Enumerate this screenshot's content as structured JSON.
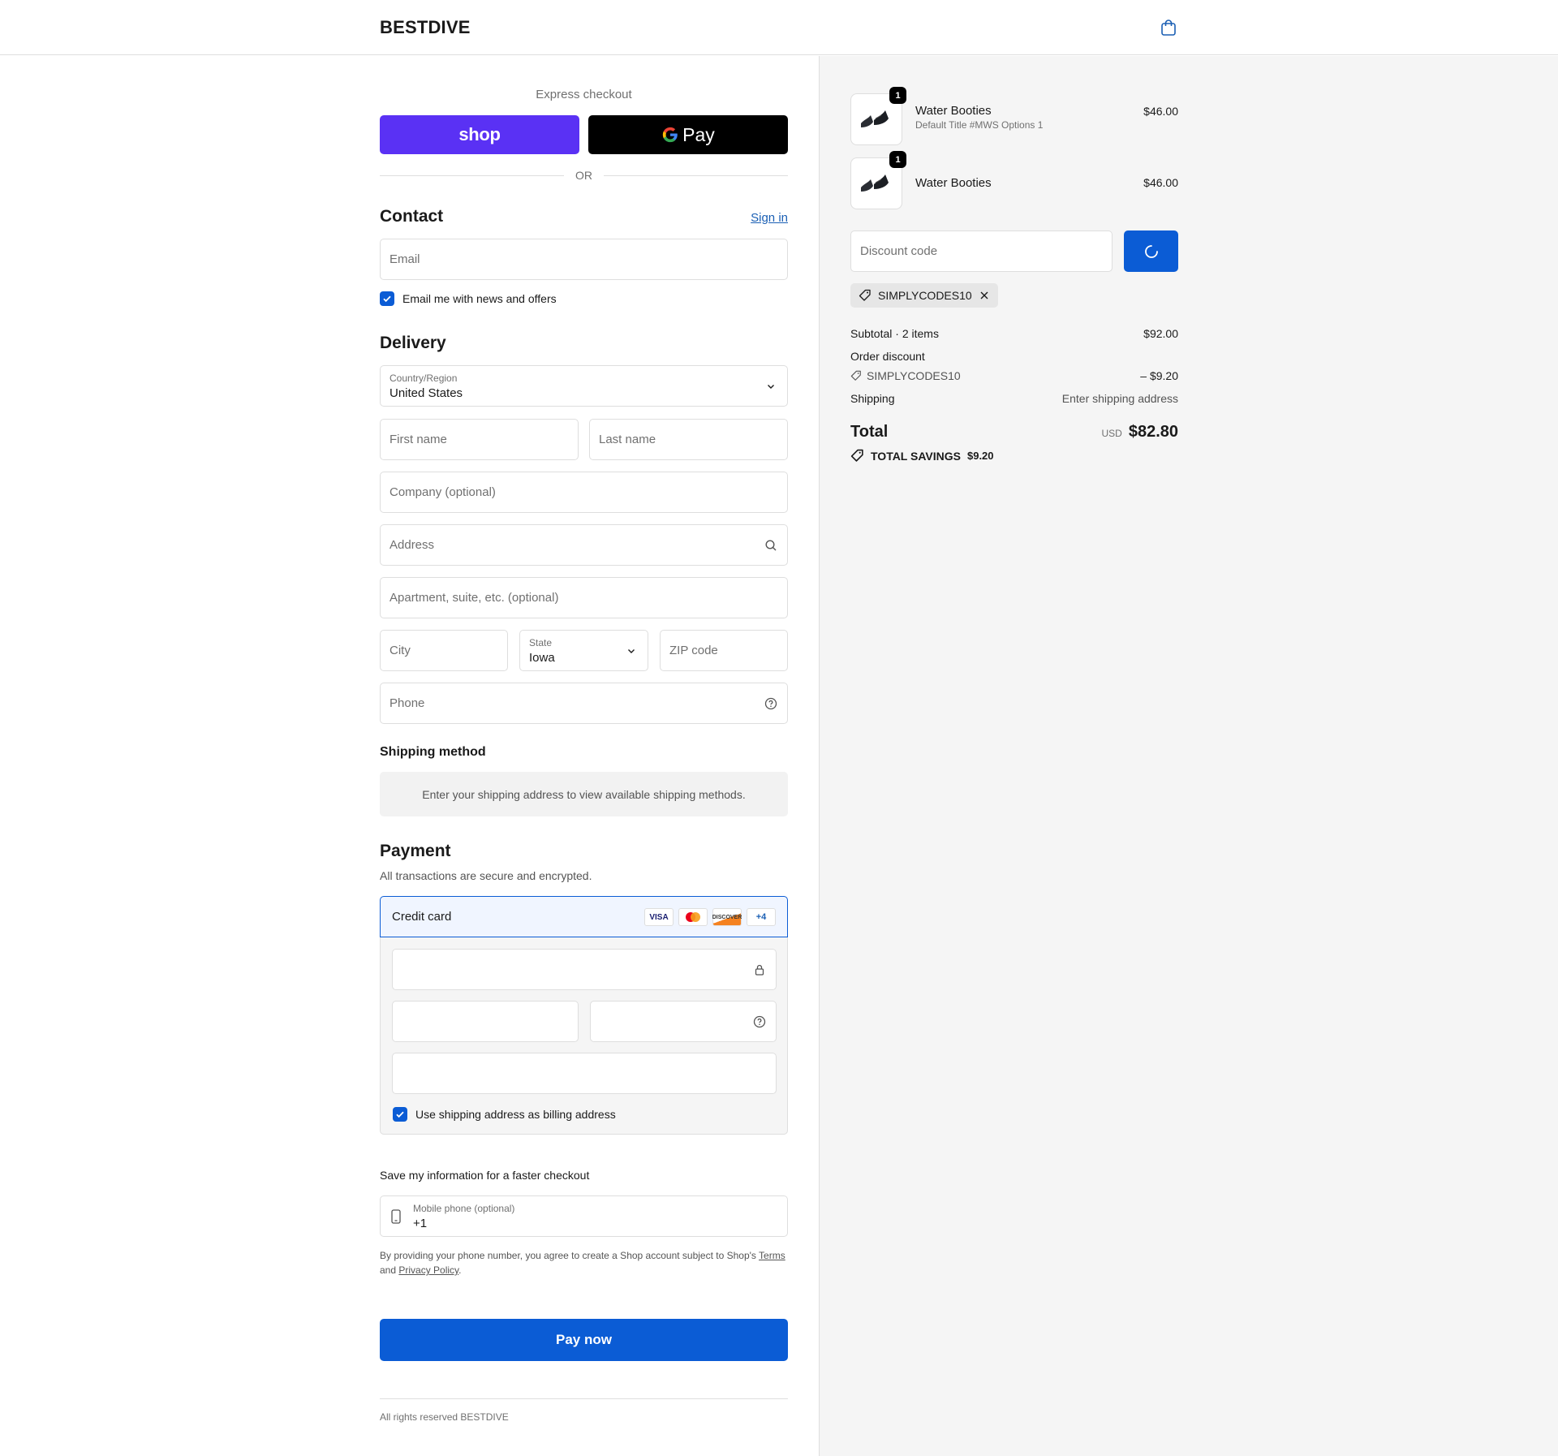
{
  "header": {
    "brand": "BESTDIVE"
  },
  "express": {
    "title": "Express checkout",
    "shop_label": "shop",
    "gpay_label": "Pay",
    "or_label": "OR"
  },
  "contact": {
    "heading": "Contact",
    "sign_in": "Sign in",
    "email_placeholder": "Email",
    "newsletter_label": "Email me with news and offers"
  },
  "delivery": {
    "heading": "Delivery",
    "country_label": "Country/Region",
    "country_value": "United States",
    "first_name": "First name",
    "last_name": "Last name",
    "company": "Company (optional)",
    "address": "Address",
    "apartment": "Apartment, suite, etc. (optional)",
    "city": "City",
    "state_label": "State",
    "state_value": "Iowa",
    "zip": "ZIP code",
    "phone": "Phone"
  },
  "shipping": {
    "heading": "Shipping method",
    "message": "Enter your shipping address to view available shipping methods."
  },
  "payment": {
    "heading": "Payment",
    "subtitle": "All transactions are secure and encrypted.",
    "method": "Credit card",
    "cards": [
      "VISA",
      "MC",
      "DISCOVER",
      "+4"
    ],
    "billing_label": "Use shipping address as billing address"
  },
  "save_info": {
    "heading": "Save my information for a faster checkout",
    "mobile_label": "Mobile phone (optional)",
    "mobile_value": "+1",
    "disclaimer_pre": "By providing your phone number, you agree to create a Shop account subject to Shop's",
    "terms": "Terms",
    "and": "and",
    "privacy": "Privacy Policy",
    "period": "."
  },
  "pay_now": "Pay now",
  "footer": "All rights reserved BESTDIVE",
  "cart": {
    "items": [
      {
        "name": "Water Booties",
        "variant": "Default Title #MWS Options 1",
        "price": "$46.00",
        "qty": "1"
      },
      {
        "name": "Water Booties",
        "variant": "",
        "price": "$46.00",
        "qty": "1"
      }
    ],
    "discount_placeholder": "Discount code",
    "applied_code": "SIMPLYCODES10",
    "subtotal_label": "Subtotal · 2 items",
    "subtotal_value": "$92.00",
    "order_discount_label": "Order discount",
    "discount_code": "SIMPLYCODES10",
    "discount_value": "– $9.20",
    "shipping_label": "Shipping",
    "shipping_value": "Enter shipping address",
    "total_label": "Total",
    "currency": "USD",
    "total_value": "$82.80",
    "savings_label": "TOTAL SAVINGS",
    "savings_value": "$9.20"
  },
  "colors": {
    "accent": "#0b5cd5",
    "shop": "#5a31f4"
  }
}
